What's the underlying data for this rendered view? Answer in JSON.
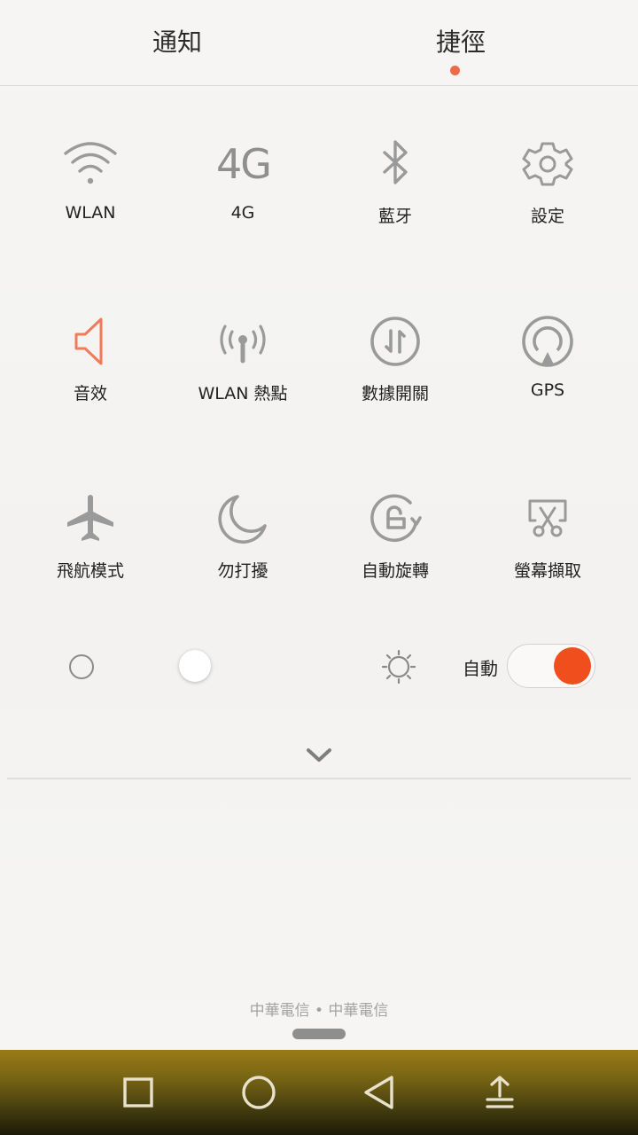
{
  "tabs": [
    {
      "label": "通知",
      "active": false
    },
    {
      "label": "捷徑",
      "active": true
    }
  ],
  "accent_color": "#f04e1c",
  "tiles": [
    {
      "label": "WLAN",
      "icon": "wifi-icon",
      "active": false
    },
    {
      "label": "4G",
      "icon_text": "4G",
      "icon": "4g-icon",
      "active": false
    },
    {
      "label": "藍牙",
      "icon": "bluetooth-icon",
      "active": false
    },
    {
      "label": "設定",
      "icon": "gear-icon",
      "active": false
    },
    {
      "label": "音效",
      "icon": "speaker-icon",
      "active": true
    },
    {
      "label": "WLAN 熱點",
      "icon": "hotspot-icon",
      "active": false
    },
    {
      "label": "數據開關",
      "icon": "data-toggle-icon",
      "active": false
    },
    {
      "label": "GPS",
      "icon": "gps-icon",
      "active": false
    },
    {
      "label": "飛航模式",
      "icon": "airplane-icon",
      "active": false
    },
    {
      "label": "勿打擾",
      "icon": "moon-icon",
      "active": false
    },
    {
      "label": "自動旋轉",
      "icon": "rotate-lock-icon",
      "active": false
    },
    {
      "label": "螢幕擷取",
      "icon": "screenshot-icon",
      "active": false
    }
  ],
  "brightness": {
    "auto_label": "自動",
    "auto_enabled": true,
    "level": 0.36
  },
  "carrier": "中華電信 • 中華電信",
  "nav": [
    "recent-apps-icon",
    "home-icon",
    "back-icon",
    "upload-icon"
  ]
}
